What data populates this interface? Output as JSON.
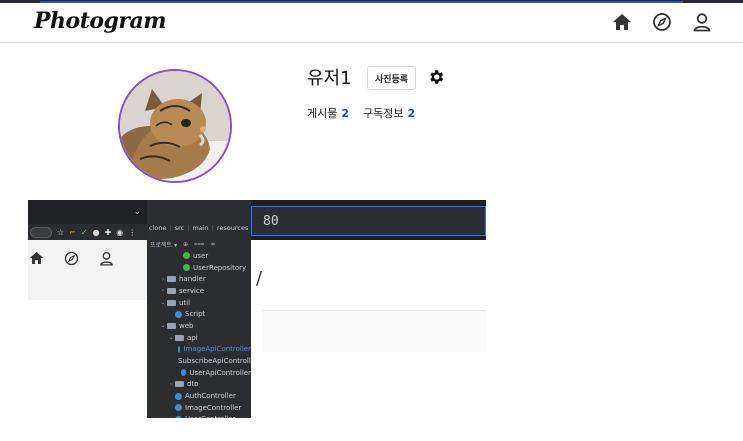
{
  "header": {
    "logo": "Photogram",
    "nav": [
      {
        "icon": "home-icon"
      },
      {
        "icon": "compass-icon"
      },
      {
        "icon": "user-icon"
      }
    ]
  },
  "profile": {
    "username": "유저1",
    "upload_button": "사진등록",
    "settings_icon": "gear-icon",
    "stats": [
      {
        "label": "게시물",
        "value": "2"
      },
      {
        "label": "구독정보",
        "value": "2"
      }
    ]
  },
  "embedded": {
    "chrome_toolbar_text": "☆",
    "ide_breadcrumbs": [
      "clone",
      "src",
      "main",
      "resources"
    ],
    "ide_projectbar": "프로젝트 ▾",
    "tree": [
      {
        "depth": 3,
        "kind": "class",
        "color": "green",
        "label": "user"
      },
      {
        "depth": 3,
        "kind": "class",
        "color": "green",
        "label": "UserRepository"
      },
      {
        "depth": 1,
        "kind": "folder",
        "arrow": "›",
        "label": "handler"
      },
      {
        "depth": 1,
        "kind": "folder",
        "arrow": "›",
        "label": "service"
      },
      {
        "depth": 1,
        "kind": "folder",
        "arrow": "⌄",
        "label": "util"
      },
      {
        "depth": 2,
        "kind": "class",
        "label": "Script"
      },
      {
        "depth": 1,
        "kind": "folder",
        "arrow": "⌄",
        "label": "web"
      },
      {
        "depth": 2,
        "kind": "folder",
        "arrow": "⌄",
        "label": "api"
      },
      {
        "depth": 3,
        "kind": "class",
        "label": "ImageApiController",
        "selected": true
      },
      {
        "depth": 3,
        "kind": "class",
        "label": "SubscribeApiController"
      },
      {
        "depth": 3,
        "kind": "class",
        "label": "UserApiController"
      },
      {
        "depth": 2,
        "kind": "folder",
        "arrow": "›",
        "label": "dto"
      },
      {
        "depth": 2,
        "kind": "class",
        "label": "AuthController"
      },
      {
        "depth": 2,
        "kind": "class",
        "label": "ImageController"
      },
      {
        "depth": 2,
        "kind": "class",
        "label": "UserController"
      }
    ],
    "editor_fragment": "80",
    "page_fragment": "/"
  },
  "colors": {
    "avatar_border": "#8a4fbf",
    "stat_value": "#1f4e9a",
    "ide_bg": "#2b2d30",
    "ide_selection": "#4b8fe3"
  }
}
